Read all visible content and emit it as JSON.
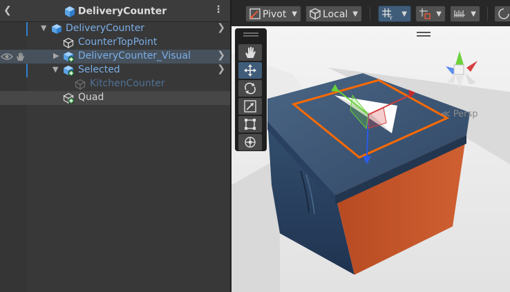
{
  "hierarchy": {
    "title": "DeliveryCounter",
    "items": [
      {
        "label": "DeliveryCounter",
        "indent_level": 0,
        "expanded": true,
        "color": "#7aaee6",
        "icon": "prefab-cube-icon"
      },
      {
        "label": "CounterTopPoint",
        "indent_level": 1,
        "expanded": false,
        "color": "#7aaee6",
        "icon": "gameobject-cube-icon"
      },
      {
        "label": "DeliveryCounter_Visual",
        "indent_level": 1,
        "expanded": false,
        "color": "#7aaee6",
        "icon": "prefab-added-icon"
      },
      {
        "label": "Selected",
        "indent_level": 1,
        "expanded": true,
        "color": "#7aaee6",
        "icon": "prefab-added-icon"
      },
      {
        "label": "KitchenCounter",
        "indent_level": 2,
        "expanded": false,
        "color": "#4f7196",
        "icon": "gameobject-cube-icon-dim"
      },
      {
        "label": "Quad",
        "indent_level": 1,
        "expanded": false,
        "color": "#d6d6d6",
        "icon": "gameobject-added-icon"
      }
    ]
  },
  "scene_toolbar": {
    "pivot_label": "Pivot",
    "local_label": "Local"
  },
  "scene": {
    "persp_label": "Persp"
  },
  "colors": {
    "selection_outline": "#ff6a00",
    "prefab_blue": "#7aaee6",
    "counter_top": "#3d5470",
    "counter_side": "#c6562a",
    "active_tool": "#3f5c79"
  }
}
